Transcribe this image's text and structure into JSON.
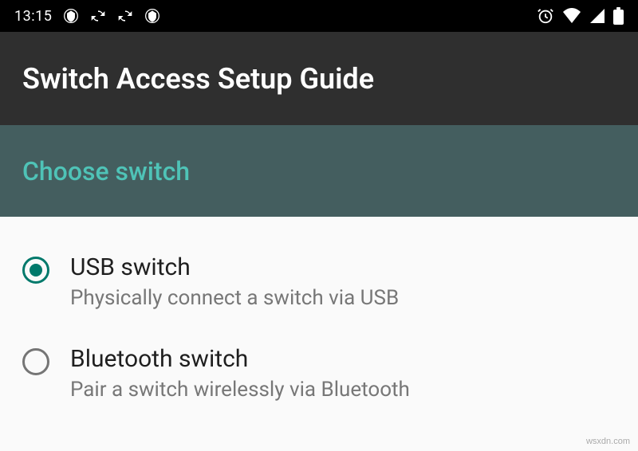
{
  "statusBar": {
    "time": "13:15"
  },
  "appBar": {
    "title": "Switch Access Setup Guide"
  },
  "section": {
    "title": "Choose switch"
  },
  "options": [
    {
      "title": "USB switch",
      "subtitle": "Physically connect a switch via USB",
      "selected": true
    },
    {
      "title": "Bluetooth switch",
      "subtitle": "Pair a switch wirelessly via Bluetooth",
      "selected": false
    }
  ],
  "watermark": "wsxdn.com"
}
